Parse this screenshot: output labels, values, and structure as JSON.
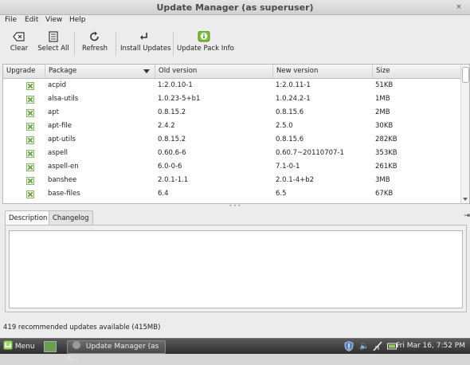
{
  "window": {
    "title": "Update Manager (as superuser)",
    "controls": [
      "×"
    ]
  },
  "menubar": {
    "file": "File",
    "edit": "Edit",
    "view": "View",
    "help": "Help"
  },
  "toolbar": {
    "clear": "Clear",
    "select_all": "Select All",
    "refresh": "Refresh",
    "install_updates": "Install Updates",
    "update_pack_info": "Update Pack Info"
  },
  "table": {
    "headers": {
      "upgrade": "Upgrade",
      "package": "Package",
      "old_version": "Old version",
      "new_version": "New version",
      "size": "Size"
    },
    "rows": [
      {
        "package": "acpid",
        "old": "1:2.0.10-1",
        "new": "1:2.0.11-1",
        "size": "51KB"
      },
      {
        "package": "alsa-utils",
        "old": "1.0.23-5+b1",
        "new": "1.0.24.2-1",
        "size": "1MB"
      },
      {
        "package": "apt",
        "old": "0.8.15.2",
        "new": "0.8.15.6",
        "size": "2MB"
      },
      {
        "package": "apt-file",
        "old": "2.4.2",
        "new": "2.5.0",
        "size": "30KB"
      },
      {
        "package": "apt-utils",
        "old": "0.8.15.2",
        "new": "0.8.15.6",
        "size": "282KB"
      },
      {
        "package": "aspell",
        "old": "0.60.6-6",
        "new": "0.60.7~20110707-1",
        "size": "353KB"
      },
      {
        "package": "aspell-en",
        "old": "6.0-0-6",
        "new": "7.1-0-1",
        "size": "261KB"
      },
      {
        "package": "banshee",
        "old": "2.0.1-1.1",
        "new": "2.0.1-4+b2",
        "size": "3MB"
      },
      {
        "package": "base-files",
        "old": "6.4",
        "new": "6.5",
        "size": "67KB"
      }
    ]
  },
  "tabs": {
    "description": "Description",
    "changelog": "Changelog"
  },
  "status": "419 recommended updates available (415MB)",
  "panel": {
    "menu_label": "Menu",
    "task_label": "Update Manager (as s...",
    "clock": "Fri Mar 16,  7:52 PM"
  },
  "colors": {
    "accent_green": "#6da243",
    "window_bg": "#ececec",
    "panel_bg": "#3a3a3a"
  }
}
